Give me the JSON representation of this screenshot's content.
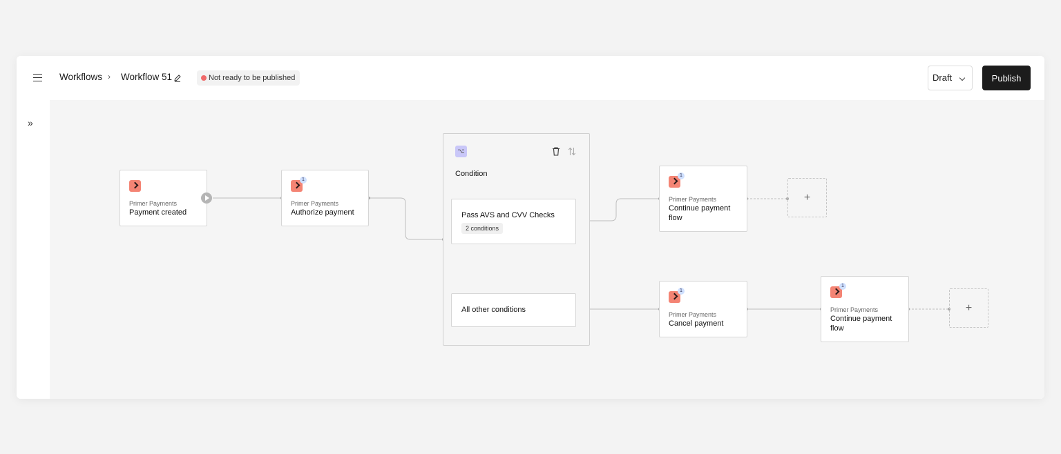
{
  "breadcrumb": {
    "root": "Workflows",
    "separator": "›",
    "current": "Workflow 51"
  },
  "status": {
    "label": "Not ready to be published",
    "color": "#f06a6a"
  },
  "header": {
    "draft_label": "Draft",
    "publish_label": "Publish"
  },
  "sidebar": {
    "expand_symbol": "»"
  },
  "nodes": {
    "trigger": {
      "provider": "Primer Payments",
      "title": "Payment created"
    },
    "authorize": {
      "provider": "Primer Payments",
      "title": "Authorize payment",
      "badge": "1"
    },
    "continue_top": {
      "provider": "Primer Payments",
      "title": "Continue payment flow",
      "badge": "1"
    },
    "cancel": {
      "provider": "Primer Payments",
      "title": "Cancel payment",
      "badge": "1"
    },
    "continue_bottom": {
      "provider": "Primer Payments",
      "title": "Continue payment flow",
      "badge": "1"
    }
  },
  "condition": {
    "label": "Condition",
    "branches": [
      {
        "title": "Pass AVS and CVV Checks",
        "tag": "2 conditions"
      },
      {
        "title": "All other conditions"
      }
    ]
  },
  "add_symbol": "+",
  "icons": {
    "menu": "hamburger-icon",
    "edit": "pencil-icon",
    "node": "primer-payments-icon",
    "condition": "branch-icon",
    "delete": "trash-icon",
    "sort": "sort-arrows-icon"
  }
}
